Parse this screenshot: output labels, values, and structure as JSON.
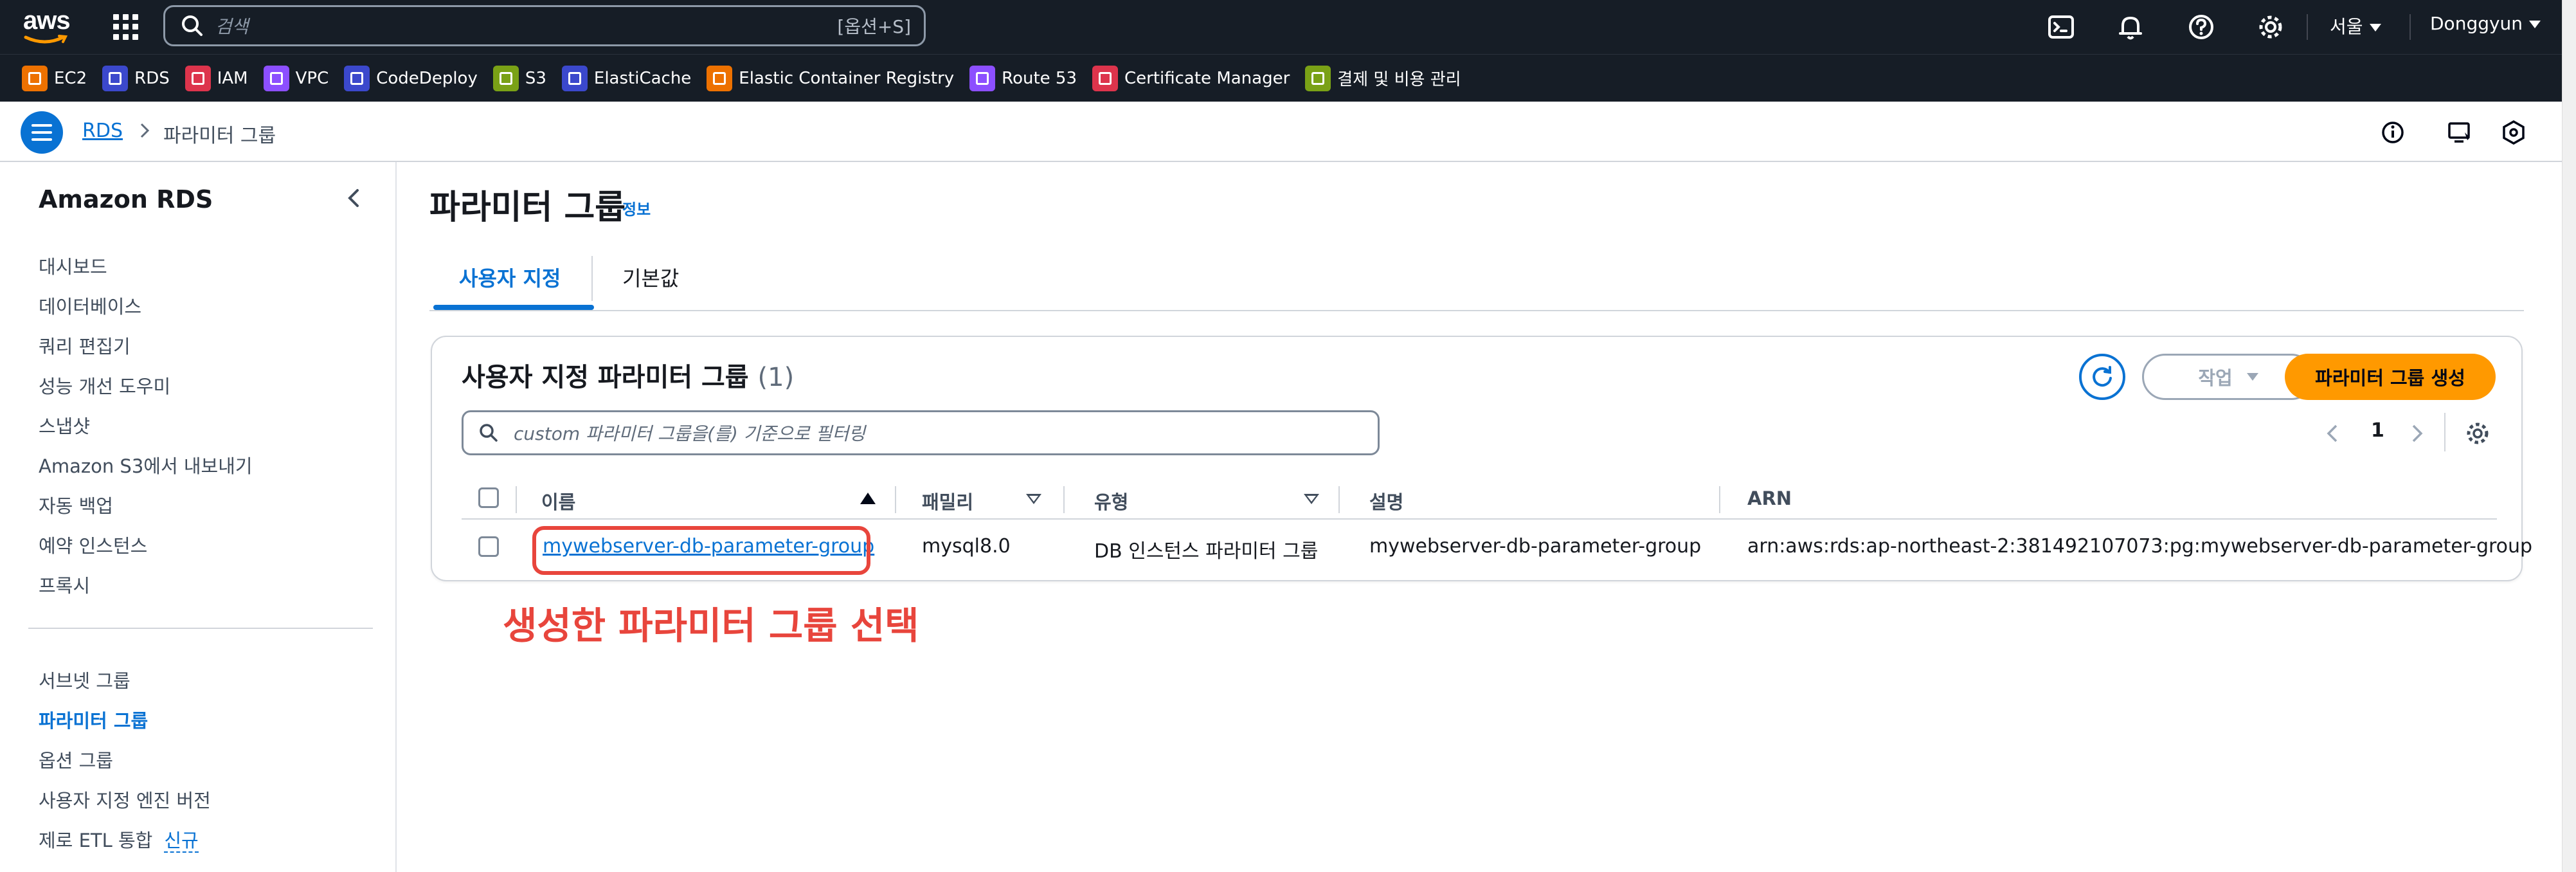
{
  "topnav": {
    "logo_text": "aws",
    "search_placeholder": "검색",
    "search_shortcut": "[옵션+S]",
    "region": "서울",
    "user": "Donggyun",
    "icons": [
      "cloudshell-icon",
      "bell-icon",
      "help-icon",
      "gear-icon"
    ]
  },
  "favorites": [
    {
      "label": "EC2",
      "color": "#ed7100"
    },
    {
      "label": "RDS",
      "color": "#3b48cc"
    },
    {
      "label": "IAM",
      "color": "#dd344c"
    },
    {
      "label": "VPC",
      "color": "#8c4fff"
    },
    {
      "label": "CodeDeploy",
      "color": "#3b48cc"
    },
    {
      "label": "S3",
      "color": "#7aa116"
    },
    {
      "label": "ElastiCache",
      "color": "#3b48cc"
    },
    {
      "label": "Elastic Container Registry",
      "color": "#ed7100"
    },
    {
      "label": "Route 53",
      "color": "#8c4fff"
    },
    {
      "label": "Certificate Manager",
      "color": "#dd344c"
    },
    {
      "label": "결제 및 비용 관리",
      "color": "#7aa116"
    }
  ],
  "breadcrumb": {
    "root": "RDS",
    "current": "파라미터 그룹"
  },
  "sidebar": {
    "title": "Amazon RDS",
    "items": [
      {
        "label": "대시보드"
      },
      {
        "label": "데이터베이스"
      },
      {
        "label": "쿼리 편집기"
      },
      {
        "label": "성능 개선 도우미"
      },
      {
        "label": "스냅샷"
      },
      {
        "label": "Amazon S3에서 내보내기"
      },
      {
        "label": "자동 백업"
      },
      {
        "label": "예약 인스턴스"
      },
      {
        "label": "프록시"
      }
    ],
    "items2": [
      {
        "label": "서브넷 그룹"
      },
      {
        "label": "파라미터 그룹",
        "active": true
      },
      {
        "label": "옵션 그룹"
      },
      {
        "label": "사용자 지정 엔진 버전"
      },
      {
        "label": "제로 ETL 통합",
        "badge": "신규"
      }
    ]
  },
  "main": {
    "title": "파라미터 그룹",
    "info": "정보",
    "tabs": [
      {
        "label": "사용자 지정",
        "active": true
      },
      {
        "label": "기본값"
      }
    ],
    "panel": {
      "title": "사용자 지정 파라미터 그룹",
      "count": "(1)",
      "action_label": "작업",
      "create_label": "파라미터 그룹 생성",
      "filter_placeholder": "custom 파라미터 그룹을(를) 기준으로 필터링",
      "page": "1",
      "columns": [
        "이름",
        "패밀리",
        "유형",
        "설명",
        "ARN"
      ],
      "rows": [
        {
          "name": "mywebserver-db-parameter-group",
          "family": "mysql8.0",
          "type": "DB 인스턴스 파라미터 그룹",
          "description": "mywebserver-db-parameter-group",
          "arn": "arn:aws:rds:ap-northeast-2:381492107073:pg:mywebserver-db-parameter-group"
        }
      ]
    }
  },
  "annotation": {
    "text": "생성한 파라미터 그룹 선택",
    "color": "#e8453c"
  },
  "colors": {
    "accent": "#0972d3",
    "primary_button": "#ff9900",
    "topbar": "#161d26"
  }
}
